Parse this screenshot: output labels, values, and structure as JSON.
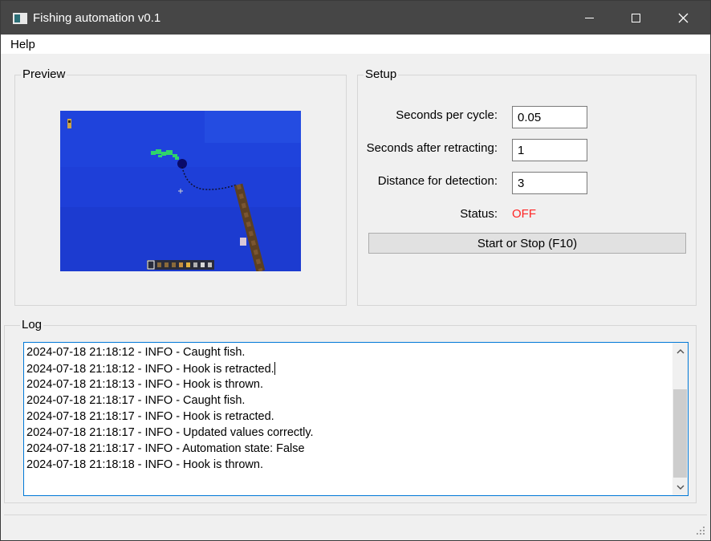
{
  "window": {
    "title": "Fishing automation v0.1",
    "icons": [
      "app-icon",
      "minimize-icon",
      "maximize-icon",
      "close-icon"
    ]
  },
  "menu": {
    "help": "Help"
  },
  "preview": {
    "title": "Preview"
  },
  "setup": {
    "title": "Setup",
    "seconds_per_cycle_label": "Seconds per cycle:",
    "seconds_per_cycle_value": "0.05",
    "seconds_after_retracting_label": "Seconds after retracting:",
    "seconds_after_retracting_value": "1",
    "distance_label": "Distance for detection:",
    "distance_value": "3",
    "status_label": "Status:",
    "status_value": "OFF",
    "status_color": "#ff2424",
    "start_stop_label": "Start or Stop (F10)"
  },
  "log": {
    "title": "Log",
    "lines": [
      "2024-07-18 21:18:12 - INFO - Caught fish.",
      "2024-07-18 21:18:12 - INFO - Hook is retracted.",
      "2024-07-18 21:18:13 - INFO - Hook is thrown.",
      "2024-07-18 21:18:17 - INFO - Caught fish.",
      "2024-07-18 21:18:17 - INFO - Hook is retracted.",
      "2024-07-18 21:18:17 - INFO - Updated values correctly.",
      "2024-07-18 21:18:17 - INFO - Automation state: False",
      "2024-07-18 21:18:18 - INFO - Hook is thrown."
    ]
  }
}
